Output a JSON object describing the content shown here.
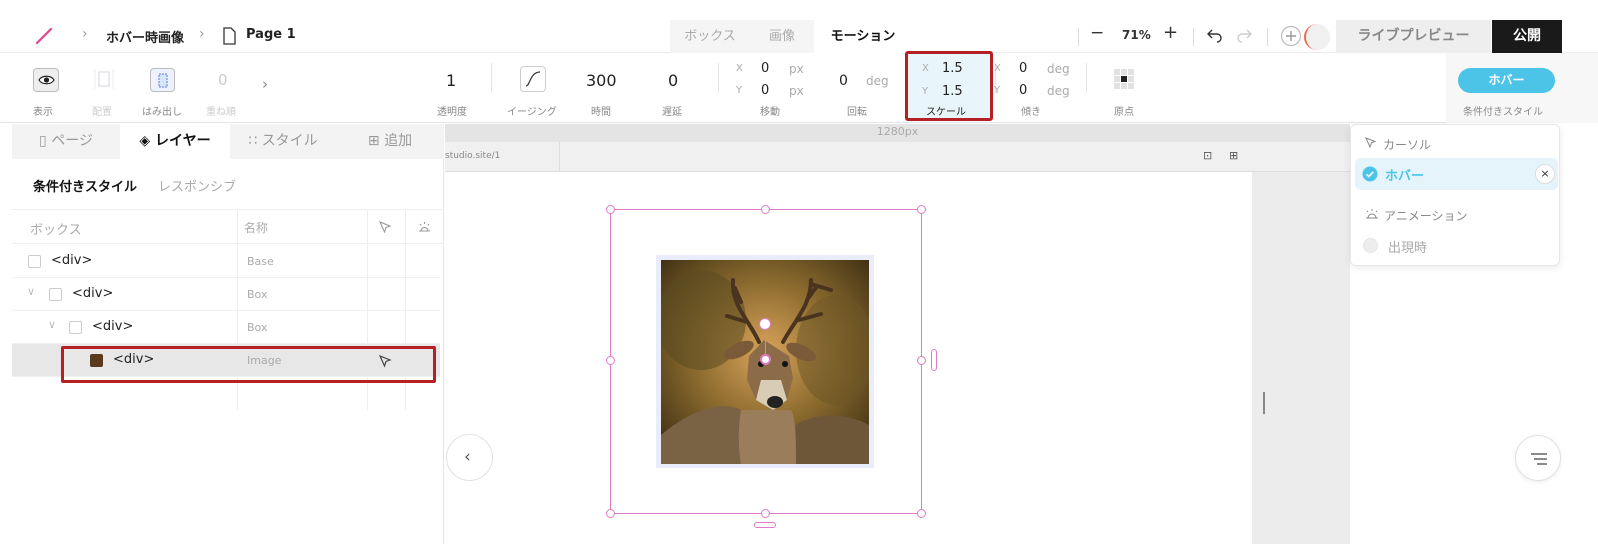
{
  "topbar": {
    "breadcrumb": [
      "ホバー時画像",
      "Page 1"
    ],
    "tabs": [
      {
        "label": "ボックス",
        "active": false
      },
      {
        "label": "画像",
        "active": false
      },
      {
        "label": "モーション",
        "active": true
      }
    ],
    "zoom": "71%",
    "zoom_minus": "−",
    "zoom_plus": "+",
    "live_preview": "ライブプレビュー",
    "publish": "公開"
  },
  "toolbar": {
    "visibility_label": "表示",
    "layout_label": "配置",
    "overflow_label": "はみ出し",
    "stack_label": "重ね順",
    "stack_value": "0",
    "opacity": {
      "value": "1",
      "label": "透明度"
    },
    "easing_label": "イージング",
    "duration": {
      "value": "300",
      "label": "時間"
    },
    "delay": {
      "value": "0",
      "label": "遅延"
    },
    "move": {
      "x": "0",
      "y": "0",
      "unit": "px",
      "label": "移動"
    },
    "rotate": {
      "value": "0",
      "unit": "deg",
      "label": "回転"
    },
    "scale": {
      "x": "1.5",
      "y": "1.5",
      "label": "スケール"
    },
    "skew": {
      "x": "0",
      "y": "0",
      "unit": "deg",
      "label": "傾き"
    },
    "origin_label": "原点",
    "cond_button": "ホバー",
    "cond_label": "条件付きスタイル",
    "axis_x": "X",
    "axis_y": "Y"
  },
  "left_panel": {
    "tabs": [
      {
        "label": "ページ",
        "active": false
      },
      {
        "label": "レイヤー",
        "active": true
      },
      {
        "label": "スタイル",
        "active": false
      },
      {
        "label": "追加",
        "active": false
      }
    ],
    "subtabs": [
      "条件付きスタイル",
      "レスポンシブ"
    ],
    "col_box": "ボックス",
    "col_name": "名称",
    "rows": [
      {
        "tag": "<div>",
        "name": "Base"
      },
      {
        "tag": "<div>",
        "name": "Box"
      },
      {
        "tag": "<div>",
        "name": "Box"
      },
      {
        "tag": "<div>",
        "name": "Image"
      }
    ]
  },
  "canvas": {
    "width_label": "1280px",
    "url": "studio.site/1"
  },
  "cond_panel": {
    "cursor_head": "カーソル",
    "hover_item": "ホバー",
    "anim_head": "アニメーション",
    "appear_item": "出現時"
  },
  "colors": {
    "accent": "#4cc4e8",
    "highlight": "#b52025",
    "selection": "#e07ac8"
  }
}
